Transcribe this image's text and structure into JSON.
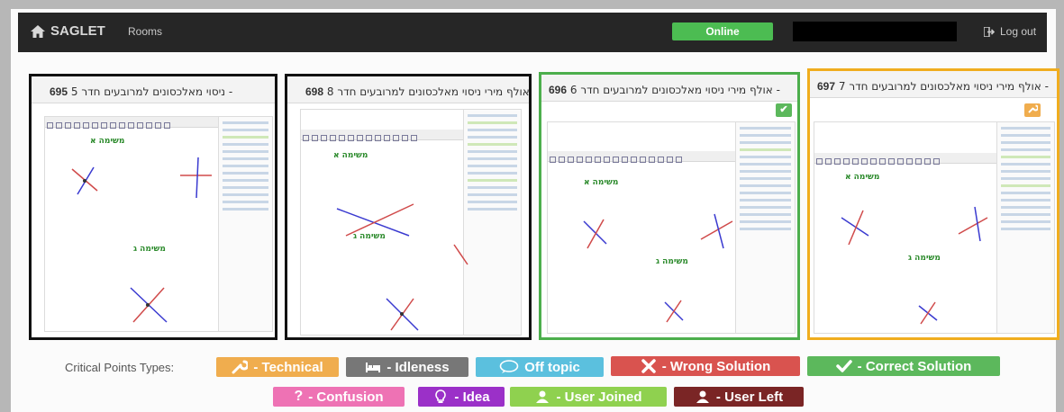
{
  "navbar": {
    "brand": "SAGLET",
    "rooms_link": "Rooms",
    "status": "Online",
    "logout": "Log out"
  },
  "rooms": [
    {
      "number": "695",
      "title": "ניסוי מאלכסונים למרובעים חדר 5 -",
      "border_color": "#111111"
    },
    {
      "number": "698",
      "title": "אולף מירי ניסוי מאלכסונים למרובעים חדר 8 -",
      "border_color": "#111111"
    },
    {
      "number": "696",
      "title": "אולף מירי ניסוי מאלכסונים למרובעים חדר 6 -",
      "border_color": "#4cae4c",
      "badge": "correct"
    },
    {
      "number": "697",
      "title": "אולף מירי ניסוי מאלכסונים למרובעים חדר 7 -",
      "border_color": "#f0ad1e",
      "badge": "technical"
    }
  ],
  "legend": {
    "label": "Critical Points Types:",
    "items": [
      {
        "label": "- Technical",
        "color": "#f0ad4e",
        "icon": "wrench-icon"
      },
      {
        "label": "- Idleness",
        "color": "#777777",
        "icon": "bed-icon"
      },
      {
        "label": "Off topic",
        "color": "#5bc0de",
        "icon": "comment-icon"
      },
      {
        "label": "- Wrong Solution",
        "color": "#d9534f",
        "icon": "x-icon"
      },
      {
        "label": "- Correct Solution",
        "color": "#5cb85c",
        "icon": "check-icon"
      },
      {
        "label": "- Confusion",
        "color": "#ee72b4",
        "icon": "question-icon"
      },
      {
        "label": "- Idea",
        "color": "#9b30c8",
        "icon": "lightbulb-icon"
      },
      {
        "label": "- User Joined",
        "color": "#8fd14f",
        "icon": "user-icon"
      },
      {
        "label": "- User Left",
        "color": "#7a2525",
        "icon": "user-icon"
      }
    ]
  }
}
